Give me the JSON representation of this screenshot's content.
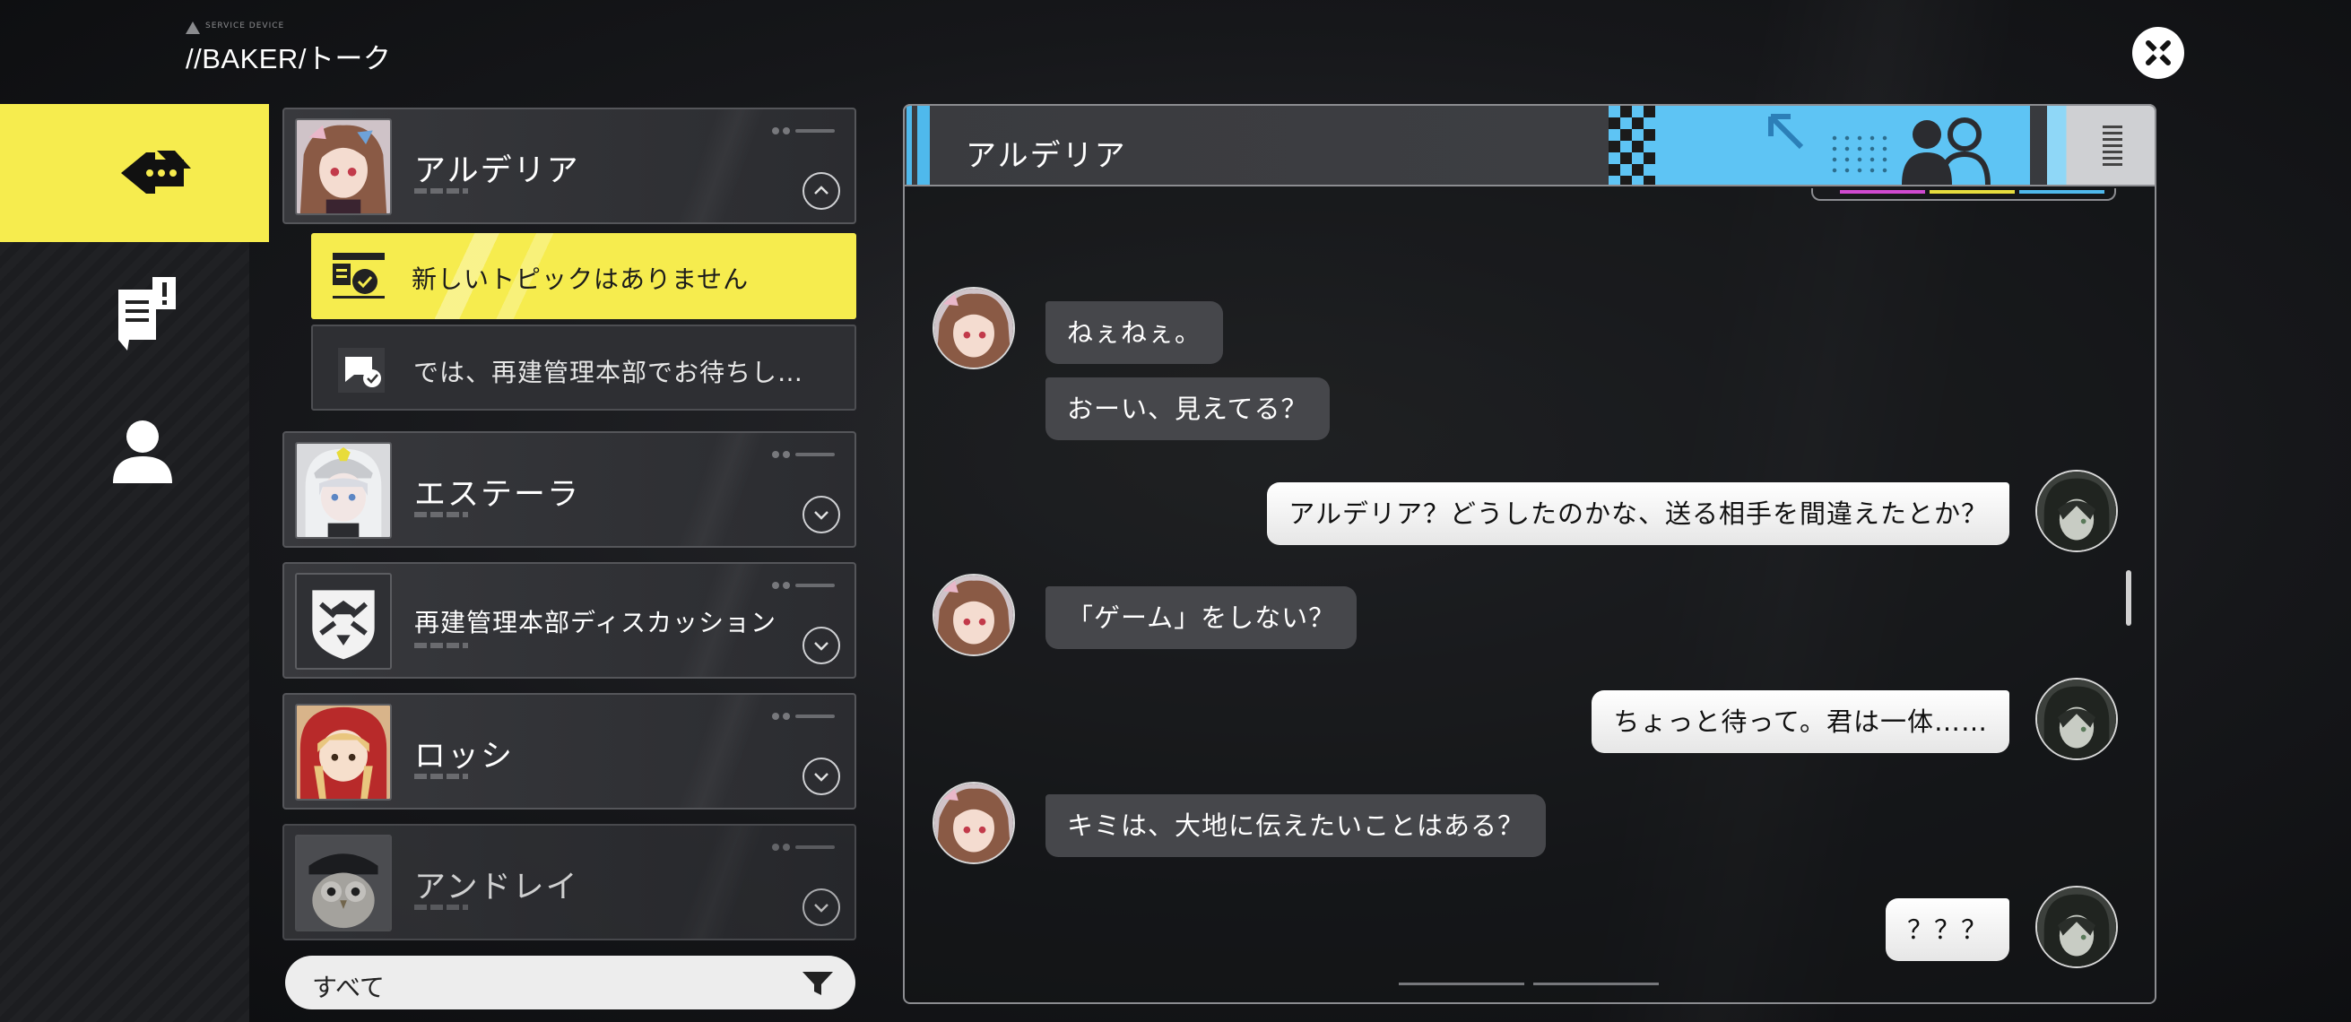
{
  "header": {
    "title": "//BAKER/トーク",
    "logo_text": "SERVICE DEVICE",
    "close_icon": "close-x-icon"
  },
  "nav": {
    "items": [
      {
        "icon": "chat-bubbles-icon",
        "active": true
      },
      {
        "icon": "document-alert-icon",
        "active": false
      },
      {
        "icon": "person-icon",
        "active": false
      }
    ]
  },
  "threads": [
    {
      "name": "アルデリア",
      "expanded": true
    },
    {
      "name": "エステーラ",
      "expanded": false
    },
    {
      "name": "再建管理本部ディスカッション",
      "expanded": false
    },
    {
      "name": "ロッシ",
      "expanded": false
    },
    {
      "name": "アンドレイ",
      "expanded": false
    }
  ],
  "topics": [
    {
      "label": "新しいトピックはありません",
      "icon": "new-topic-icon"
    },
    {
      "label": "では、再建管理本部でお待ちし…",
      "icon": "read-chat-icon"
    }
  ],
  "filter": {
    "label": "すべて",
    "icon": "filter-funnel-icon"
  },
  "chat": {
    "title": "アルデリア",
    "messages": [
      {
        "side": "left",
        "text": "ねぇねぇ。"
      },
      {
        "side": "left",
        "text": "おーい、見えてる？"
      },
      {
        "side": "right",
        "text": "アルデリア？どうしたのかな、送る相手を間違えたとか？"
      },
      {
        "side": "left",
        "text": "「ゲーム」をしない？"
      },
      {
        "side": "right",
        "text": "ちょっと待って。君は一体……"
      },
      {
        "side": "left",
        "text": "キミは、大地に伝えたいことはある？"
      },
      {
        "side": "right",
        "text": "？？？"
      }
    ]
  },
  "colors": {
    "accent_yellow": "#f6ec4e",
    "accent_blue": "#5ec4f4",
    "bubble_left": "#46474b",
    "bubble_right": "#ffffff"
  }
}
